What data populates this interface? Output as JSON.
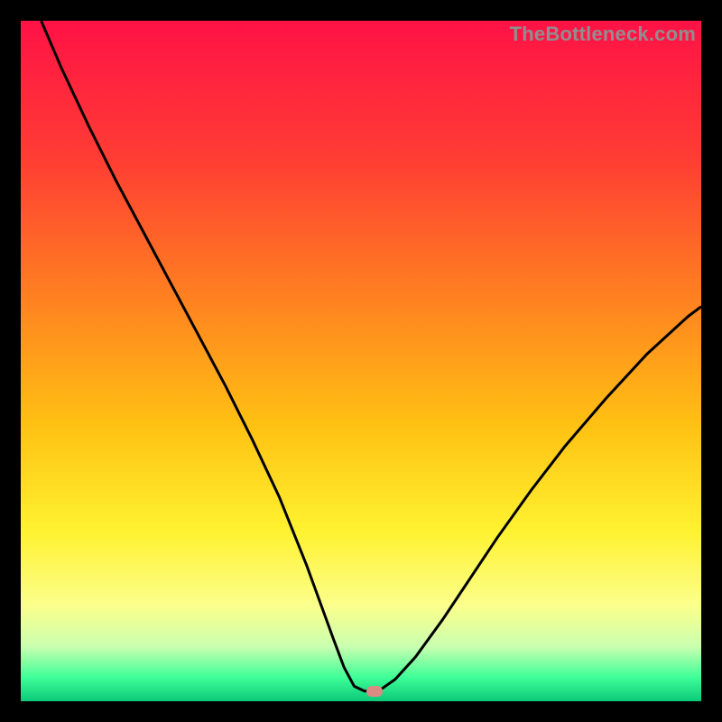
{
  "watermark": {
    "text": "TheBottleneck.com"
  },
  "chart_data": {
    "type": "line",
    "title": "",
    "xlabel": "",
    "ylabel": "",
    "xlim": [
      0,
      100
    ],
    "ylim": [
      0,
      100
    ],
    "grid": false,
    "legend": false,
    "gradient_stops": [
      {
        "offset": 0.0,
        "color": "#ff1246"
      },
      {
        "offset": 0.2,
        "color": "#ff3c34"
      },
      {
        "offset": 0.4,
        "color": "#ff7e21"
      },
      {
        "offset": 0.6,
        "color": "#ffc313"
      },
      {
        "offset": 0.75,
        "color": "#fff230"
      },
      {
        "offset": 0.86,
        "color": "#fbff8c"
      },
      {
        "offset": 0.92,
        "color": "#c9ffb0"
      },
      {
        "offset": 0.965,
        "color": "#3dff97"
      },
      {
        "offset": 1.0,
        "color": "#0cc97a"
      }
    ],
    "series": [
      {
        "name": "bottleneck-curve",
        "color": "#000000",
        "stroke_width": 3,
        "x": [
          3,
          6,
          10,
          14,
          18,
          22,
          26,
          30,
          34,
          38,
          42,
          44,
          46,
          47.5,
          49,
          50.5,
          52,
          53,
          55,
          58,
          62,
          66,
          70,
          75,
          80,
          86,
          92,
          98,
          100
        ],
        "y": [
          100,
          93,
          84.5,
          76.5,
          69,
          61.5,
          54,
          46.5,
          38.5,
          30,
          20,
          14.5,
          9,
          5,
          2.2,
          1.5,
          1.5,
          1.8,
          3.2,
          6.5,
          12,
          18,
          24,
          31,
          37.5,
          44.5,
          51,
          56.5,
          58
        ]
      }
    ],
    "flat_segment": {
      "x_start": 47.5,
      "x_end": 53,
      "y": 1.5
    },
    "marker": {
      "name": "optimum-point",
      "x": 52,
      "y": 1.5,
      "color": "#d98b84"
    }
  }
}
